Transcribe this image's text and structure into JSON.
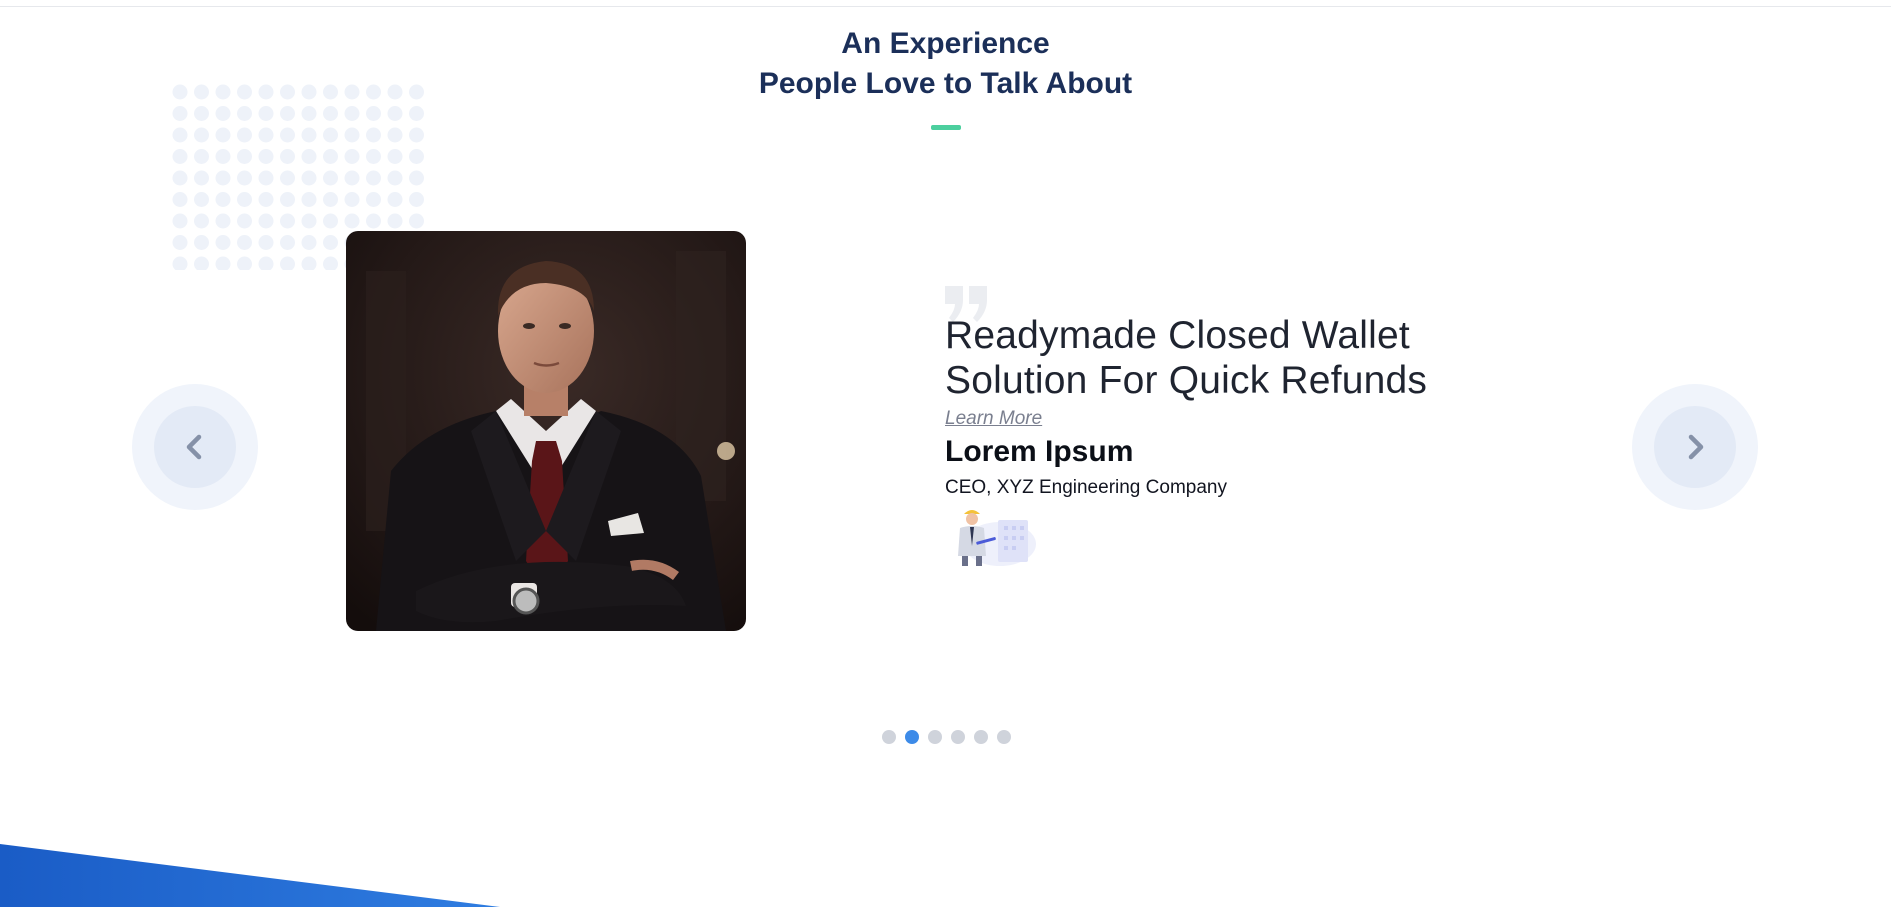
{
  "section": {
    "heading_line1": "An Experience",
    "heading_line2": "People Love to Talk About"
  },
  "testimonial": {
    "headline_line1": "Readymade Closed Wallet",
    "headline_line2": "Solution For Quick Refunds",
    "learn_more": "Learn More",
    "name": "Lorem Ipsum",
    "title": "CEO, XYZ Engineering Company",
    "photo": "portrait-man-in-suit",
    "logo": "engineer-illustration"
  },
  "carousel": {
    "prev_icon": "chevron-left-icon",
    "next_icon": "chevron-right-icon",
    "slide_count": 6,
    "active_slide": 2
  },
  "colors": {
    "heading": "#1b2f59",
    "accent": "#4ccf9e",
    "pager_active": "#3d8be8",
    "pager_inactive": "#cfd3db",
    "footer_blue": "#1d5ec9"
  }
}
